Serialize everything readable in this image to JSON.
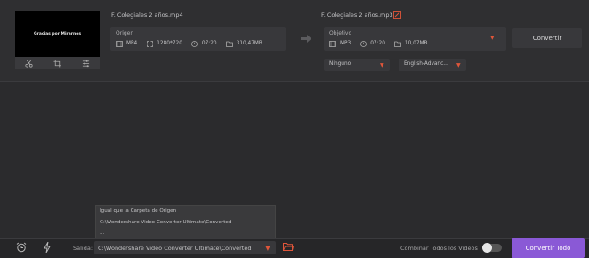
{
  "item": {
    "thumbnail_text": "Gracias por Mirarnos",
    "source_filename": "F. Colegiales 2 años.mp4",
    "target_filename": "F. Colegiales 2 años.mp3",
    "origin": {
      "label": "Origen",
      "format": "MP4",
      "resolution": "1280*720",
      "duration": "07:20",
      "size": "310,47MB"
    },
    "target": {
      "label": "Objetivo",
      "format": "MP3",
      "duration": "07:20",
      "size": "10,07MB"
    },
    "convert_label": "Convertir",
    "subtitle_select": "Ninguno",
    "audio_select": "English-Advanc..."
  },
  "output_menu": {
    "items": [
      "Igual que la Carpeta de Origen",
      "C:\\Wondershare Video Converter Ultimate\\Converted",
      "..."
    ]
  },
  "bottom_bar": {
    "output_label": "Salida:",
    "output_path": "C:\\Wondershare Video Converter Ultimate\\Converted",
    "combine_label": "Combinar Todos los Videos",
    "combine_enabled": false,
    "convert_all_label": "Convertir Todo"
  },
  "colors": {
    "accent_orange": "#e0563a",
    "convert_all_purple": "#8a59d6",
    "background": "#2b2b2d"
  }
}
